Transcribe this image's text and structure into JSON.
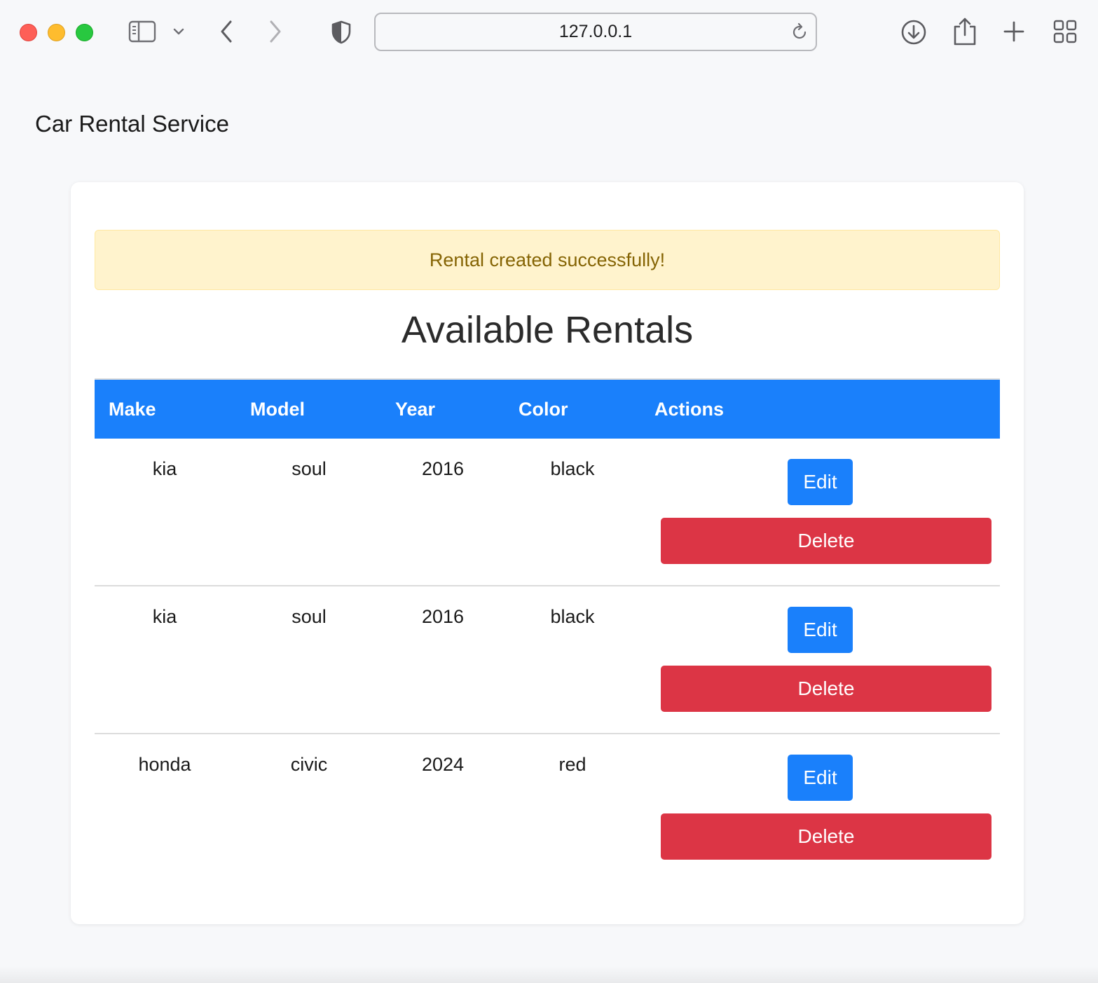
{
  "browser": {
    "url": "127.0.0.1"
  },
  "app": {
    "brand": "Car Rental Service"
  },
  "alert": {
    "message": "Rental created successfully!"
  },
  "page": {
    "title": "Available Rentals"
  },
  "table": {
    "headers": [
      "Make",
      "Model",
      "Year",
      "Color",
      "Actions"
    ],
    "rows": [
      {
        "make": "kia",
        "model": "soul",
        "year": "2016",
        "color": "black"
      },
      {
        "make": "kia",
        "model": "soul",
        "year": "2016",
        "color": "black"
      },
      {
        "make": "honda",
        "model": "civic",
        "year": "2024",
        "color": "red"
      }
    ],
    "edit_label": "Edit",
    "delete_label": "Delete"
  },
  "colors": {
    "primary": "#1a80fb",
    "danger": "#dc3545",
    "alert_bg": "#fff3cd",
    "alert_text": "#856404"
  }
}
